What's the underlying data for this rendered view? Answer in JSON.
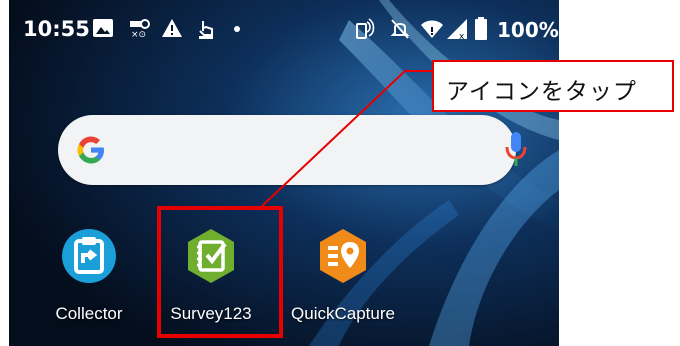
{
  "status_bar": {
    "time": "10:55",
    "battery_percent": "100%",
    "left_icons": [
      "gallery-icon",
      "voicemail-icon",
      "warning-icon",
      "touch-icon",
      "dot-icon"
    ],
    "right_icons": [
      "nfc-icon",
      "mute-icon",
      "wifi-icon",
      "signal-icon",
      "battery-icon"
    ]
  },
  "search_bar": {
    "icons": [
      "google-g-icon",
      "microphone-icon"
    ]
  },
  "apps": [
    {
      "label": "Collector",
      "icon": "clipboard-icon",
      "color": "#1a9fd9"
    },
    {
      "label": "Survey123",
      "icon": "checklist-icon",
      "color": "#6fae2f"
    },
    {
      "label": "QuickCapture",
      "icon": "location-list-icon",
      "color": "#f08a18"
    }
  ],
  "annotation": {
    "callout_text": "アイコンをタップ",
    "highlight_color": "#e60000"
  }
}
